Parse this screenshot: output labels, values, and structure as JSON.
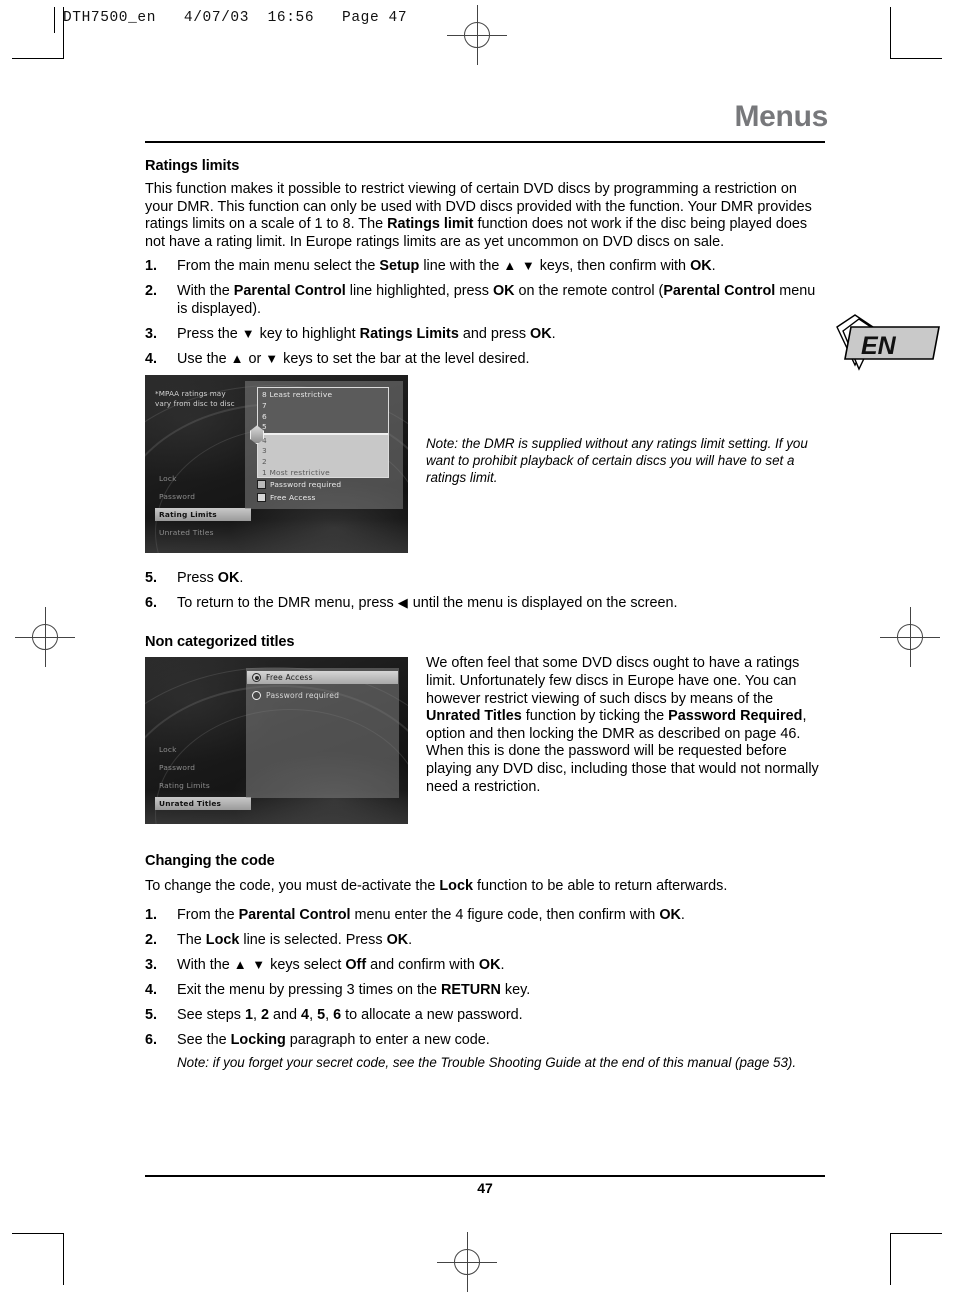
{
  "print_header": {
    "text": "DTH7500_en   4/07/03  16:56   Page 47"
  },
  "page": {
    "running_head": "Menus",
    "page_number": "47",
    "language_tab": "EN"
  },
  "sections": {
    "ratings_limits": {
      "heading": "Ratings limits",
      "intro_parts": [
        {
          "t": "This function makes it possible to restrict viewing of certain DVD discs by programming a restriction on your DMR. This function can only be used with DVD discs provided with the function. Your DMR provides ratings limits on a scale of 1 to 8. The ",
          "b": false
        },
        {
          "t": "Ratings limit",
          "b": true
        },
        {
          "t": " function does not work if the disc being played does not have a rating limit. In Europe ratings limits are as yet uncommon on DVD discs on sale.",
          "b": false
        }
      ],
      "steps": [
        {
          "num": "1.",
          "parts": [
            {
              "t": "From the main menu select the ",
              "b": false
            },
            {
              "t": "Setup",
              "b": true
            },
            {
              "t": " line with the ",
              "b": false
            },
            {
              "t": "▲ ▼",
              "b": false,
              "arrow": true
            },
            {
              "t": " keys, then confirm with ",
              "b": false
            },
            {
              "t": "OK",
              "b": true
            },
            {
              "t": ".",
              "b": false
            }
          ]
        },
        {
          "num": "2.",
          "parts": [
            {
              "t": "With the ",
              "b": false
            },
            {
              "t": "Parental Control",
              "b": true
            },
            {
              "t": " line highlighted, press ",
              "b": false
            },
            {
              "t": "OK",
              "b": true
            },
            {
              "t": " on the remote control (",
              "b": false
            },
            {
              "t": "Parental Control",
              "b": true
            },
            {
              "t": " menu is displayed).",
              "b": false
            }
          ]
        },
        {
          "num": "3.",
          "parts": [
            {
              "t": "Press the ",
              "b": false
            },
            {
              "t": "▼",
              "b": false,
              "arrow": true
            },
            {
              "t": " key to highlight ",
              "b": false
            },
            {
              "t": "Ratings Limits",
              "b": true
            },
            {
              "t": " and press ",
              "b": false
            },
            {
              "t": "OK",
              "b": true
            },
            {
              "t": ".",
              "b": false
            }
          ]
        },
        {
          "num": "4.",
          "parts": [
            {
              "t": "Use the ",
              "b": false
            },
            {
              "t": "▲",
              "b": false,
              "arrow": true
            },
            {
              "t": " or ",
              "b": false
            },
            {
              "t": "▼",
              "b": false,
              "arrow": true
            },
            {
              "t": " keys to set the bar at the level desired.",
              "b": false
            }
          ]
        }
      ],
      "figure_note": "Note: the DMR is supplied without any ratings limit setting. If you want to prohibit playback of certain discs you will have to set a ratings limit.",
      "steps_after": [
        {
          "num": "5.",
          "parts": [
            {
              "t": "Press ",
              "b": false
            },
            {
              "t": "OK",
              "b": true
            },
            {
              "t": ".",
              "b": false
            }
          ]
        },
        {
          "num": "6.",
          "parts": [
            {
              "t": "To return to the DMR menu, press ",
              "b": false
            },
            {
              "t": "◀",
              "b": false,
              "arrow": true
            },
            {
              "t": " until the menu is displayed on the screen.",
              "b": false
            }
          ]
        }
      ]
    },
    "non_categorized": {
      "heading": "Non categorized titles",
      "body_parts": [
        {
          "t": "We often feel that some DVD discs ought to have a ratings limit. Unfortunately few discs in Europe have one. You can however restrict viewing of such discs by means of the ",
          "b": false
        },
        {
          "t": "Unrated Titles",
          "b": true
        },
        {
          "t": " function by ticking the ",
          "b": false
        },
        {
          "t": "Password Required",
          "b": true
        },
        {
          "t": ", option and then locking the DMR as described on page 46. When this is done the password will be requested before playing any DVD disc, including those that would not normally need a restriction.",
          "b": false
        }
      ]
    },
    "changing_code": {
      "heading": "Changing the code",
      "intro_parts": [
        {
          "t": "To change the code, you must de-activate the ",
          "b": false
        },
        {
          "t": "Lock",
          "b": true
        },
        {
          "t": " function to be able to return afterwards.",
          "b": false
        }
      ],
      "steps": [
        {
          "num": "1.",
          "parts": [
            {
              "t": "From the ",
              "b": false
            },
            {
              "t": "Parental Control",
              "b": true
            },
            {
              "t": " menu enter the 4 figure code, then confirm with ",
              "b": false
            },
            {
              "t": "OK",
              "b": true
            },
            {
              "t": ".",
              "b": false
            }
          ]
        },
        {
          "num": "2.",
          "parts": [
            {
              "t": "The ",
              "b": false
            },
            {
              "t": "Lock",
              "b": true
            },
            {
              "t": " line is selected. Press ",
              "b": false
            },
            {
              "t": "OK",
              "b": true
            },
            {
              "t": ".",
              "b": false
            }
          ]
        },
        {
          "num": "3.",
          "parts": [
            {
              "t": "With the ",
              "b": false
            },
            {
              "t": "▲ ▼",
              "b": false,
              "arrow": true
            },
            {
              "t": " keys select ",
              "b": false
            },
            {
              "t": "Off",
              "b": true
            },
            {
              "t": " and confirm with ",
              "b": false
            },
            {
              "t": "OK",
              "b": true
            },
            {
              "t": ".",
              "b": false
            }
          ]
        },
        {
          "num": "4.",
          "parts": [
            {
              "t": "Exit the menu by pressing 3 times on the ",
              "b": false
            },
            {
              "t": "RETURN",
              "b": true
            },
            {
              "t": " key.",
              "b": false
            }
          ]
        },
        {
          "num": "5.",
          "parts": [
            {
              "t": "See steps ",
              "b": false
            },
            {
              "t": "1",
              "b": true
            },
            {
              "t": ", ",
              "b": false
            },
            {
              "t": "2",
              "b": true
            },
            {
              "t": " and ",
              "b": false
            },
            {
              "t": "4",
              "b": true
            },
            {
              "t": ", ",
              "b": false
            },
            {
              "t": "5",
              "b": true
            },
            {
              "t": ", ",
              "b": false
            },
            {
              "t": "6",
              "b": true
            },
            {
              "t": " to allocate a new password.",
              "b": false
            }
          ]
        },
        {
          "num": "6.",
          "parts": [
            {
              "t": "See the ",
              "b": false
            },
            {
              "t": "Locking",
              "b": true
            },
            {
              "t": " paragraph to enter a new code.",
              "b": false
            }
          ]
        }
      ],
      "final_note": "Note: if you forget your secret code, see the Trouble Shooting Guide at the end of this manual (page 53)."
    }
  },
  "screenshot_ratings": {
    "mpaa_note": "*MPAA ratings may\nvary from disc to disc",
    "menu_items": [
      {
        "label": "Lock",
        "selected": false
      },
      {
        "label": "Password",
        "selected": false
      },
      {
        "label": "Rating Limits",
        "selected": true
      },
      {
        "label": "Unrated Titles",
        "selected": false
      }
    ],
    "rating_rows_upper": [
      "8 Least restrictive",
      "7",
      "6",
      "5"
    ],
    "rating_rows_lower": [
      "4",
      "3",
      "2",
      "1 Most restrictive"
    ],
    "checkboxes": [
      {
        "label": "Password required"
      },
      {
        "label": "Free Access"
      }
    ]
  },
  "screenshot_unrated": {
    "menu_items": [
      {
        "label": "Lock",
        "selected": false
      },
      {
        "label": "Password",
        "selected": false
      },
      {
        "label": "Rating Limits",
        "selected": false
      },
      {
        "label": "Unrated Titles",
        "selected": true
      }
    ],
    "options": [
      {
        "label": "Free Access",
        "selected": true
      },
      {
        "label": "Password required",
        "selected": false
      }
    ]
  }
}
